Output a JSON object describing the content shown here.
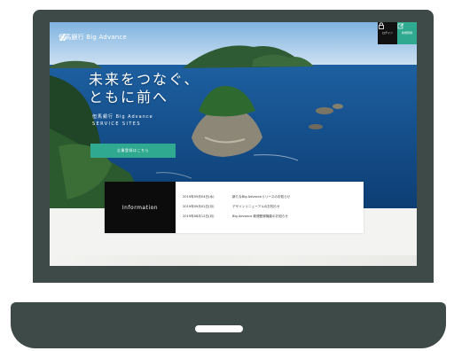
{
  "brand": {
    "logo_text": "但馬銀行 Big Advance",
    "accent": "#2fa98f",
    "dark": "#3d4a47"
  },
  "header": {
    "login_label": "ログイン",
    "register_label": "新規登録"
  },
  "hero": {
    "headline": "未来をつなぐ、\nともに前へ",
    "subtitle_1": "但馬銀行 Big Advance",
    "subtitle_2": "SERVICE SITES",
    "cta_label": "企業登録はこちら"
  },
  "info": {
    "label": "Information",
    "items": [
      {
        "date": "2019年09月04日(水)",
        "text": "新たなBig Advanceリリースのお知らせ"
      },
      {
        "date": "2019年09月02日(月)",
        "text": "デザインリニューアルのお知らせ"
      },
      {
        "date": "2019年08月12日(月)",
        "text": "Big Advance 新規登録機能のお知らせ"
      }
    ]
  }
}
